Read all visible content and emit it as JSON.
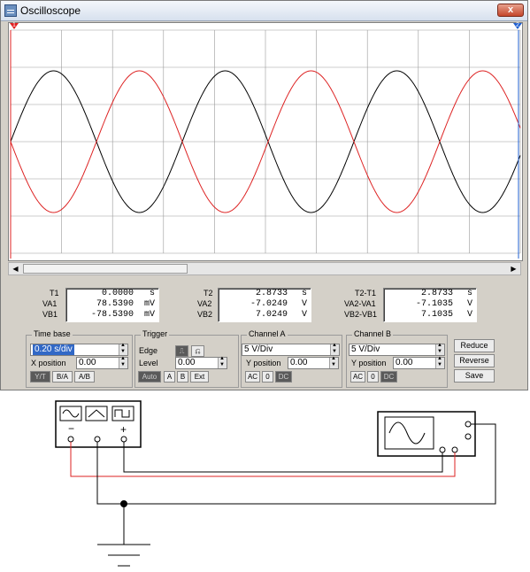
{
  "window": {
    "title": "Oscilloscope",
    "close_label": "x"
  },
  "cursors": {
    "t1_marker": "1",
    "t2_marker": "2"
  },
  "colors": {
    "channel_a_trace": "#000000",
    "channel_b_trace": "#dd2222",
    "grid": "#9a9a9a",
    "wire_red": "#dd2222"
  },
  "readout": {
    "col1": {
      "rows": [
        {
          "label": "T1",
          "value": "0.0000",
          "unit": "s"
        },
        {
          "label": "VA1",
          "value": "78.5390",
          "unit": "mV"
        },
        {
          "label": "VB1",
          "value": "-78.5390",
          "unit": "mV"
        }
      ]
    },
    "col2": {
      "rows": [
        {
          "label": "T2",
          "value": "2.8733",
          "unit": "s"
        },
        {
          "label": "VA2",
          "value": "-7.0249",
          "unit": "V"
        },
        {
          "label": "VB2",
          "value": "7.0249",
          "unit": "V"
        }
      ]
    },
    "col3": {
      "rows": [
        {
          "label": "T2-T1",
          "value": "2.8733",
          "unit": "s"
        },
        {
          "label": "VA2-VA1",
          "value": "-7.1035",
          "unit": "V"
        },
        {
          "label": "VB2-VB1",
          "value": "7.1035",
          "unit": "V"
        }
      ]
    }
  },
  "timebase": {
    "title": "Time base",
    "scale": "0.20 s/div",
    "xpos_label": "X position",
    "xpos_value": "0.00",
    "mode_yt": "Y/T",
    "mode_ba": "B/A",
    "mode_ab": "A/B"
  },
  "trigger": {
    "title": "Trigger",
    "edge_label": "Edge",
    "level_label": "Level",
    "level_value": "0.00",
    "auto": "Auto",
    "a": "A",
    "b": "B",
    "ext": "Ext"
  },
  "channel_a": {
    "title": "Channel A",
    "scale": "5 V/Div",
    "ypos_label": "Y position",
    "ypos_value": "0.00",
    "ac": "AC",
    "zero": "0",
    "dc": "DC"
  },
  "channel_b": {
    "title": "Channel B",
    "scale": "5 V/Div",
    "ypos_label": "Y position",
    "ypos_value": "0.00",
    "ac": "AC",
    "zero": "0",
    "dc": "DC"
  },
  "side_buttons": {
    "reduce": "Reduce",
    "reverse": "Reverse",
    "save": "Save"
  },
  "function_generator": {
    "minus": "−",
    "common": "o",
    "plus": "+"
  }
}
